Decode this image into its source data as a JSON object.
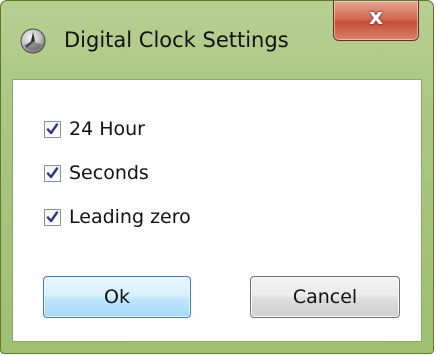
{
  "window": {
    "title": "Digital Clock Settings",
    "close_label": "x",
    "app_icon": "clock-icon",
    "frame_color": "#a9c780",
    "close_color": "#c44f37"
  },
  "options": [
    {
      "label": "24 Hour",
      "checked": true
    },
    {
      "label": "Seconds",
      "checked": true
    },
    {
      "label": "Leading zero",
      "checked": true
    }
  ],
  "buttons": {
    "ok_label": "Ok",
    "cancel_label": "Cancel"
  }
}
